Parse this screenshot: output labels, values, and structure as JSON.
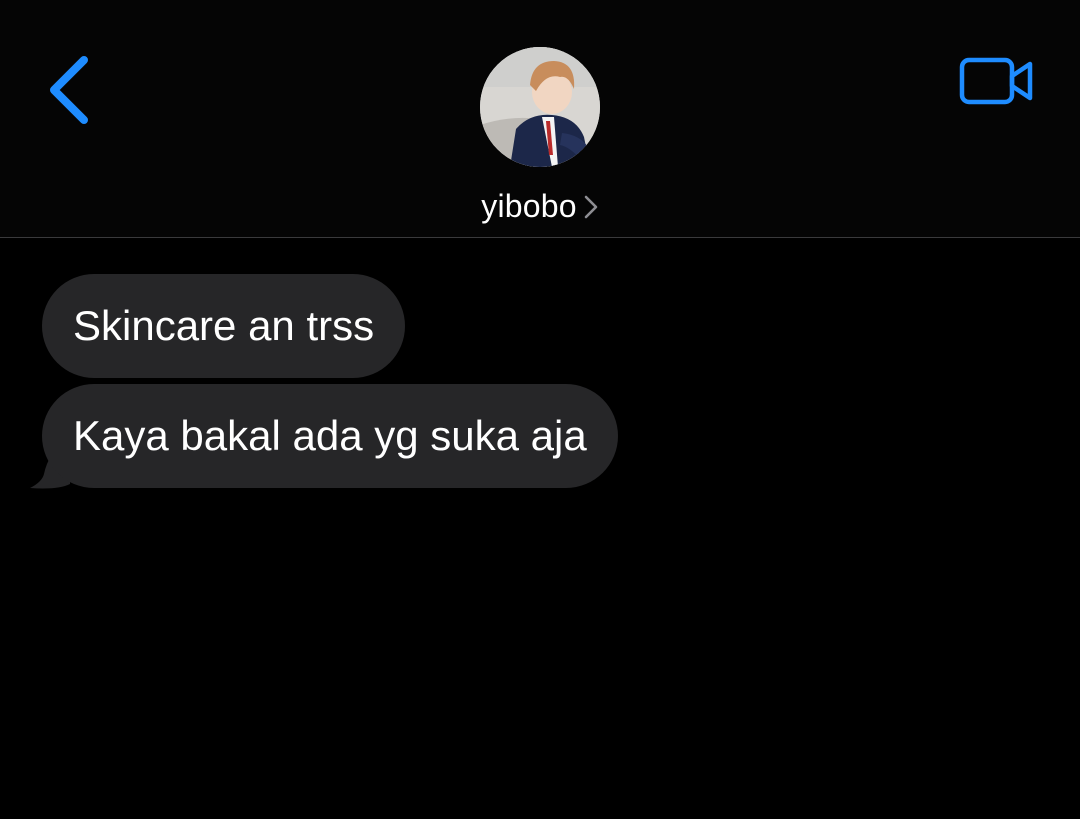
{
  "header": {
    "back_icon": "chevron-left-icon",
    "video_icon": "video-camera-icon",
    "contact_name": "yibobo",
    "contact_chevron_icon": "chevron-right-icon",
    "accent_color": "#1e8cff"
  },
  "messages": [
    {
      "text": "Skincare an trss",
      "direction": "incoming"
    },
    {
      "text": "Kaya bakal ada yg suka aja",
      "direction": "incoming"
    }
  ],
  "colors": {
    "background": "#000000",
    "incoming_bubble": "#262628",
    "divider": "#3a3a3c"
  }
}
